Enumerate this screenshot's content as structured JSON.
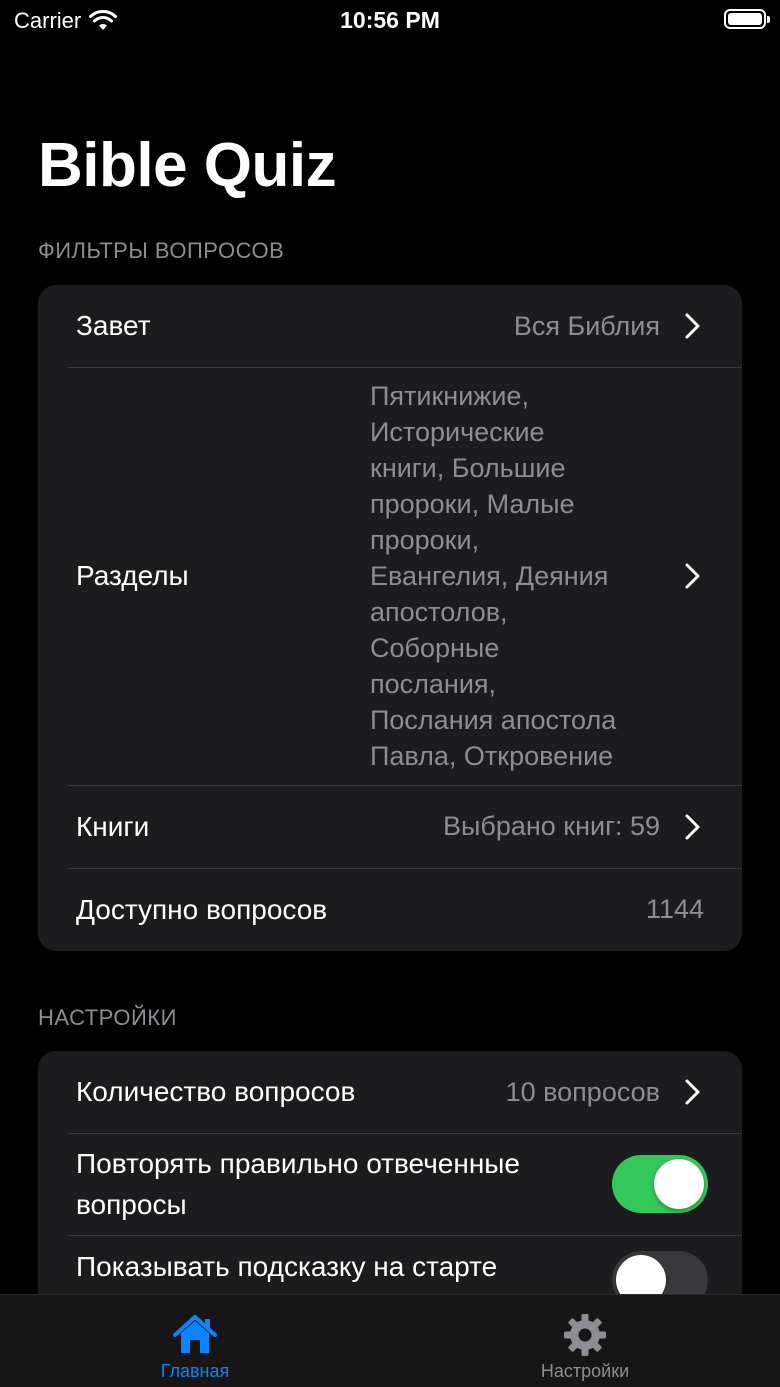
{
  "status_bar": {
    "carrier": "Carrier",
    "time": "10:56 PM"
  },
  "page": {
    "title": "Bible Quiz"
  },
  "filters": {
    "header": "ФИЛЬТРЫ ВОПРОСОВ",
    "testament": {
      "label": "Завет",
      "value": "Вся Библия"
    },
    "sections": {
      "label": "Разделы",
      "lines": [
        "Пятикнижие,",
        "Исторические",
        "книги, Большие",
        "пророки, Малые",
        "пророки,",
        "Евангелия, Деяния",
        "апостолов,",
        "Соборные",
        "послания,",
        "Послания апостола",
        "Павла, Откровение"
      ]
    },
    "books": {
      "label": "Книги",
      "value": "Выбрано книг: 59"
    },
    "available": {
      "label": "Доступно вопросов",
      "value": "1144"
    }
  },
  "settings": {
    "header": "НАСТРОЙКИ",
    "question_count": {
      "label": "Количество вопросов",
      "value": "10 вопросов"
    },
    "repeat_correct": {
      "line1": "Повторять правильно отвеченные",
      "line2": "вопросы",
      "enabled": true
    },
    "show_hint": {
      "label": "Показывать подсказку на старте",
      "enabled": false
    }
  },
  "tabs": [
    {
      "label": "Главная",
      "icon": "house-icon",
      "active": true
    },
    {
      "label": "Настройки",
      "icon": "gear-icon",
      "active": false
    }
  ],
  "colors": {
    "accent": "#0a84ff",
    "toggle_on": "#34c759",
    "card": "#1c1c1e",
    "secondary_text": "#8d8d93"
  }
}
